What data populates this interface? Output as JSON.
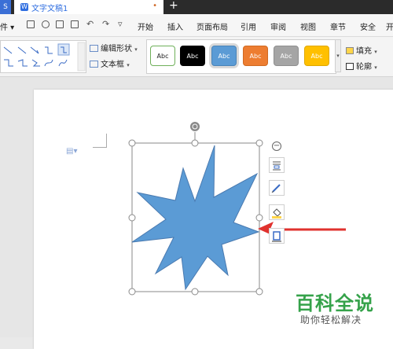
{
  "window": {
    "app_badge": "S",
    "doc_tab_title": "文字文稿1",
    "tab_close_glyph": "•",
    "new_tab_glyph": "+"
  },
  "menubar": {
    "file_glyph": "件 ▾",
    "undo_glyph": "↶",
    "redo_glyph": "↷",
    "more_glyph": "▿",
    "items": [
      "开始",
      "插入",
      "页面布局",
      "引用",
      "审阅",
      "视图",
      "章节",
      "安全",
      "开"
    ]
  },
  "ribbon": {
    "edit_shape_label": "编辑形状",
    "text_box_label": "文本框",
    "dropdown_glyph": "▾",
    "styles": [
      {
        "label": "Abc",
        "bg": "#ffffff",
        "fg": "#222222",
        "border": "#6fb05a"
      },
      {
        "label": "Abc",
        "bg": "#000000",
        "fg": "#ffffff",
        "border": "#000000"
      },
      {
        "label": "Abc",
        "bg": "#5b9bd5",
        "fg": "#ffffff",
        "border": "#4a84b8"
      },
      {
        "label": "Abc",
        "bg": "#ed7d31",
        "fg": "#ffffff",
        "border": "#d06a22"
      },
      {
        "label": "Abc",
        "bg": "#a5a5a5",
        "fg": "#ffffff",
        "border": "#8f8f8f"
      },
      {
        "label": "Abc",
        "bg": "#ffc000",
        "fg": "#ffffff",
        "border": "#e0a800"
      }
    ],
    "fill_label": "填充",
    "outline_label": "轮廓"
  },
  "document": {
    "shape_fill": "#5b9bd5",
    "arrow_color": "#e0322e",
    "collapse_glyph": "−"
  },
  "watermark": {
    "title": "百科全说",
    "subtitle": "助你轻松解决"
  }
}
